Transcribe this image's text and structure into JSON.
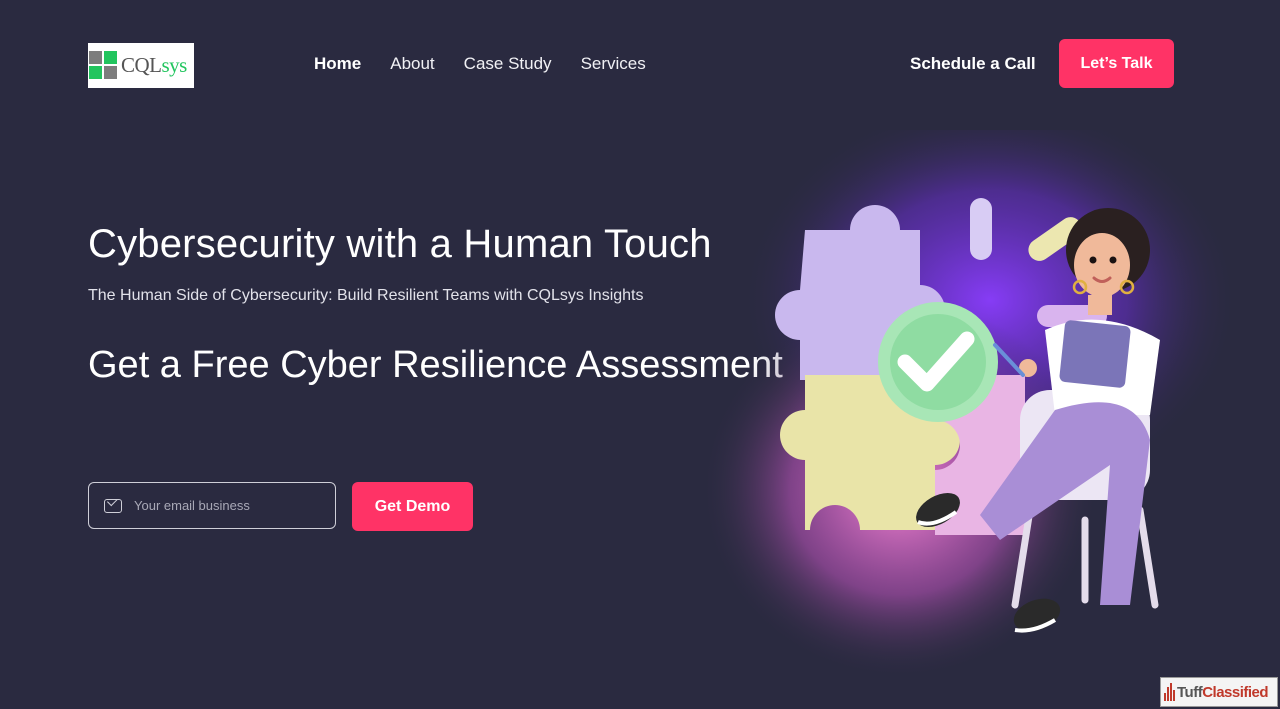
{
  "header": {
    "logo_text_a": "CQL",
    "logo_text_b": "sys",
    "nav": [
      {
        "label": "Home",
        "active": true
      },
      {
        "label": "About"
      },
      {
        "label": "Case Study"
      },
      {
        "label": "Services"
      }
    ],
    "schedule_label": "Schedule a Call",
    "talk_label": "Let’s Talk"
  },
  "hero": {
    "title": "Cybersecurity with a Human Touch",
    "subtitle": "The Human Side of Cybersecurity: Build Resilient Teams with CQLsys Insights",
    "offer": "Get a Free Cyber Resilience Assessment"
  },
  "form": {
    "email_placeholder": "Your email business",
    "email_value": "",
    "demo_label": "Get Demo"
  },
  "illustration": {
    "icon": "woman-with-tablet-puzzle-checkmark"
  },
  "watermark": {
    "text_a": "Tuff",
    "text_b": "Classified"
  },
  "colors": {
    "background": "#2a2a40",
    "accent": "#ff3366",
    "logo_green": "#22c55e"
  }
}
